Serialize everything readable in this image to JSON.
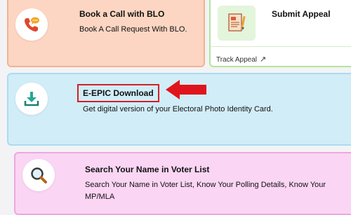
{
  "cards": {
    "blo": {
      "title": "Book a Call with BLO",
      "description": "Book A Call Request With BLO.",
      "icon": "phone-chat-icon"
    },
    "appeal": {
      "title": "Submit Appeal",
      "link_label": "Track Appeal",
      "link_icon": "arrow-up-right-icon",
      "icon": "appeal-form-icon"
    },
    "epic": {
      "title": "E-EPIC Download",
      "description": "Get digital version of your Electoral Photo Identity Card.",
      "icon": "download-tray-icon"
    },
    "search": {
      "title": "Search Your Name in Voter List",
      "description": "Search Your Name in Voter List, Know Your Polling Details, Know Your MP/MLA",
      "icon": "magnifier-icon"
    }
  },
  "colors": {
    "blo_bg": "#fcd6c2",
    "epic_bg": "#d1edf7",
    "search_bg": "#fbd5f4",
    "appeal_border": "#b4e49d",
    "highlight_red": "#d31f27"
  }
}
